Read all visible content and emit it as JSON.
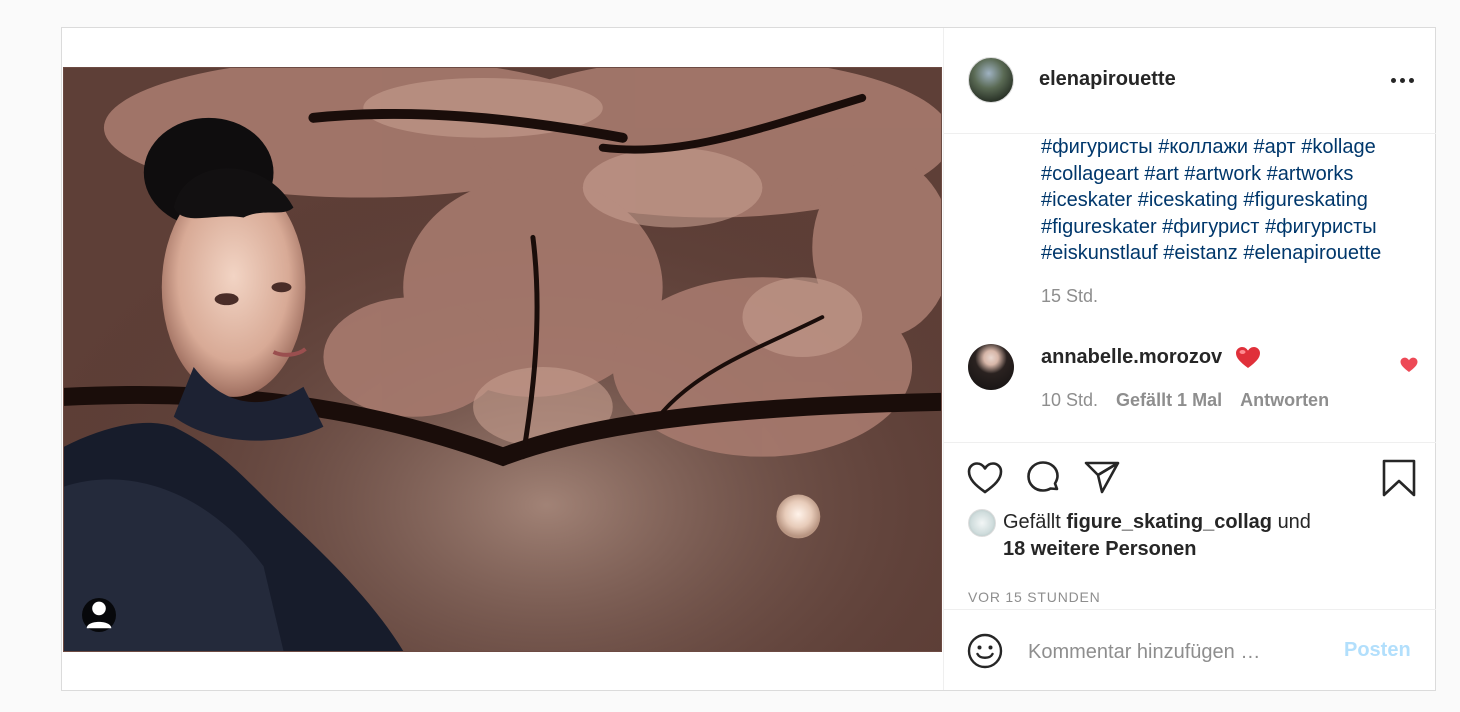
{
  "post": {
    "owner_username": "elenapirouette",
    "caption_hashtags": [
      "#фигуристы #коллажи #арт #kollage",
      "#collageart #art #artwork #artworks",
      "#iceskater #iceskating #figureskating",
      "#figureskater #фигурист #фигуристы",
      "#eiskunstlauf #eistanz #elenapirouette"
    ],
    "caption_time": "15 Std.",
    "more_icon": "more-horizontal-icon",
    "tag_icon": "user-tag-icon"
  },
  "comment": {
    "username": "annabelle.morozov",
    "emoji": "❤️",
    "time": "10 Std.",
    "likes": "Gefällt 1 Mal",
    "reply": "Antworten",
    "liked": true,
    "like_color": "#ed4956"
  },
  "actions": {
    "icons": [
      "heart-icon",
      "comment-icon",
      "share-icon",
      "bookmark-icon"
    ]
  },
  "likes": {
    "prefix": "Gefällt",
    "user": "figure_skating_collag",
    "connector": "und",
    "others": "18 weitere Personen"
  },
  "timestamp": "VOR 15 STUNDEN",
  "add_comment": {
    "placeholder": "Kommentar hinzufügen …",
    "post_label": "Posten",
    "post_color": "#b2dffc"
  }
}
